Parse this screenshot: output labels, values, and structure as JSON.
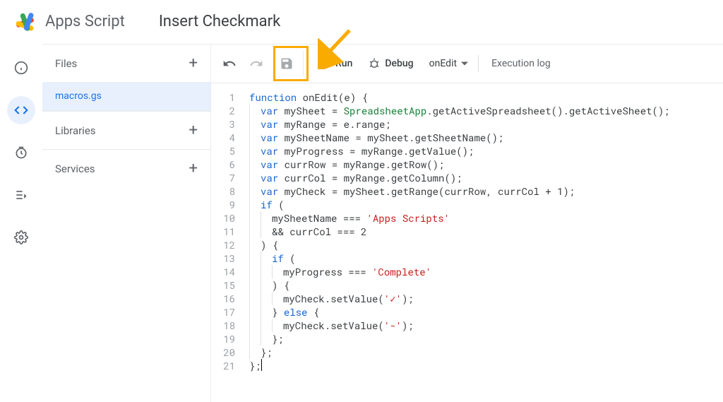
{
  "header": {
    "app_name": "Apps Script",
    "project_name": "Insert Checkmark"
  },
  "rail": {
    "items": [
      "info",
      "code",
      "triggers",
      "executions",
      "settings"
    ],
    "active": "code"
  },
  "sidebar": {
    "files_label": "Files",
    "libraries_label": "Libraries",
    "services_label": "Services",
    "files": [
      "macros.gs"
    ]
  },
  "toolbar": {
    "run_label": "Run",
    "debug_label": "Debug",
    "fn_selected": "onEdit",
    "exec_log_label": "Execution log"
  },
  "code": {
    "lines": [
      [
        {
          "t": "function ",
          "c": "kw"
        },
        {
          "t": "onEdit(e) {"
        }
      ],
      [
        {
          "i": 1
        },
        {
          "t": "var ",
          "c": "kw"
        },
        {
          "t": "mySheet = "
        },
        {
          "t": "SpreadsheetApp",
          "c": "cls"
        },
        {
          "t": ".getActiveSpreadsheet().getActiveSheet();"
        }
      ],
      [
        {
          "i": 1
        },
        {
          "t": "var ",
          "c": "kw"
        },
        {
          "t": "myRange = e.range;"
        }
      ],
      [
        {
          "i": 1
        },
        {
          "t": "var ",
          "c": "kw"
        },
        {
          "t": "mySheetName = mySheet.getSheetName();"
        }
      ],
      [
        {
          "i": 1
        },
        {
          "t": "var ",
          "c": "kw"
        },
        {
          "t": "myProgress = myRange.getValue();"
        }
      ],
      [
        {
          "i": 1
        },
        {
          "t": "var ",
          "c": "kw"
        },
        {
          "t": "currRow = myRange.getRow();"
        }
      ],
      [
        {
          "i": 1
        },
        {
          "t": "var ",
          "c": "kw"
        },
        {
          "t": "currCol = myRange.getColumn();"
        }
      ],
      [
        {
          "i": 1
        },
        {
          "t": "var ",
          "c": "kw"
        },
        {
          "t": "myCheck = mySheet.getRange(currRow, currCol + 1);"
        }
      ],
      [
        {
          "i": 1
        },
        {
          "t": "if ",
          "c": "kw"
        },
        {
          "t": "("
        }
      ],
      [
        {
          "i": 2
        },
        {
          "t": "mySheetName === "
        },
        {
          "t": "'Apps Scripts'",
          "c": "str"
        }
      ],
      [
        {
          "i": 2
        },
        {
          "t": "&& currCol === 2"
        }
      ],
      [
        {
          "i": 1
        },
        {
          "t": ") {"
        }
      ],
      [
        {
          "i": 2
        },
        {
          "t": "if ",
          "c": "kw"
        },
        {
          "t": "("
        }
      ],
      [
        {
          "i": 3
        },
        {
          "t": "myProgress === "
        },
        {
          "t": "'Complete'",
          "c": "str"
        }
      ],
      [
        {
          "i": 2
        },
        {
          "t": ") {"
        }
      ],
      [
        {
          "i": 3
        },
        {
          "t": "myCheck.setValue("
        },
        {
          "t": "'✓'",
          "c": "str"
        },
        {
          "t": ");"
        }
      ],
      [
        {
          "i": 2
        },
        {
          "t": "} "
        },
        {
          "t": "else ",
          "c": "kw"
        },
        {
          "t": "{"
        }
      ],
      [
        {
          "i": 3
        },
        {
          "t": "myCheck.setValue("
        },
        {
          "t": "'-'",
          "c": "str"
        },
        {
          "t": ");"
        }
      ],
      [
        {
          "i": 2
        },
        {
          "t": "};"
        }
      ],
      [
        {
          "i": 1
        },
        {
          "t": "};"
        }
      ],
      [
        {
          "t": "};"
        }
      ]
    ]
  }
}
